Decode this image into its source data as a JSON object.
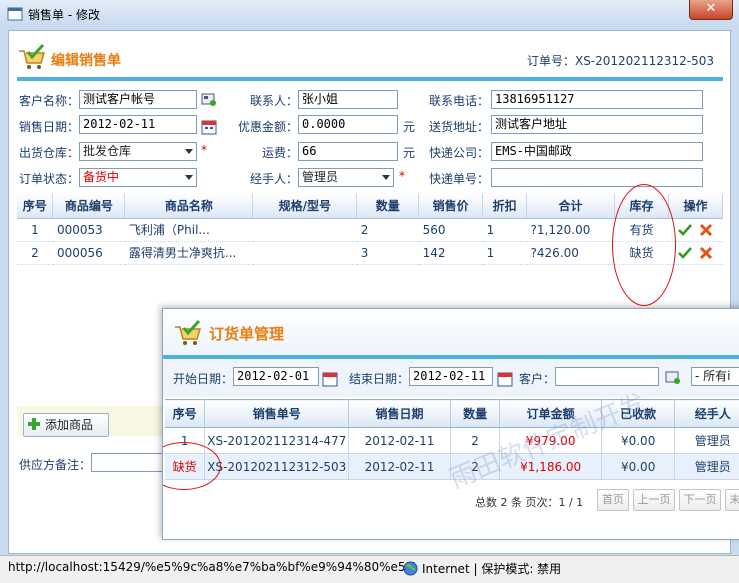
{
  "window": {
    "title": "销售单 - 修改",
    "close_label": "✕"
  },
  "form": {
    "header_title": "编辑销售单",
    "order_no_label": "订单号：",
    "order_no": "XS-201202112312-503",
    "customer_label": "客户名称：",
    "customer": "测试客户帐号",
    "contact_label": "联系人：",
    "contact": "张小姐",
    "phone_label": "联系电话：",
    "phone": "13816951127",
    "date_label": "销售日期：",
    "date": "2012-02-11",
    "discount_label": "优惠金额：",
    "discount": "0.0000",
    "discount_unit": "元",
    "address_label": "送货地址：",
    "address": "测试客户地址",
    "warehouse_label": "出货仓库：",
    "warehouse": "批发仓库",
    "freight_label": "运费：",
    "freight": "66",
    "freight_unit": "元",
    "courier_label": "快递公司：",
    "courier": "EMS-中国邮政",
    "status_label": "订单状态：",
    "status": "备货中",
    "handler_label": "经手人：",
    "handler": "管理员",
    "tracking_label": "快递单号：",
    "tracking": "",
    "required_mark": "*"
  },
  "detail": {
    "headers": [
      "序号",
      "商品编号",
      "商品名称",
      "规格/型号",
      "数量",
      "销售价",
      "折扣",
      "合计",
      "库存",
      "操作"
    ],
    "rows": [
      {
        "no": "1",
        "code": "000053",
        "name": "飞利浦（Phil...",
        "spec": "",
        "qty": "2",
        "price": "560",
        "discount": "1",
        "total": "?1,120.00",
        "stock": "有货"
      },
      {
        "no": "2",
        "code": "000056",
        "name": "露得清男士净爽抗...",
        "spec": "",
        "qty": "3",
        "price": "142",
        "discount": "1",
        "total": "?426.00",
        "stock": "缺货"
      }
    ],
    "add_button": "添加商品",
    "supplier_label": "供应方备注："
  },
  "statusbar": {
    "url": "http://localhost:15429/%e5%9c%a8%e7%ba%bf%e9%94%80%e5%",
    "zone": "Internet | 保护模式: 禁用"
  },
  "overlay": {
    "title": "订货单管理",
    "start_label": "开始日期：",
    "start": "2012-02-01",
    "end_label": "结束日期：",
    "end": "2012-02-11",
    "customer_label": "客户：",
    "customer": "",
    "all_option": "- 所有i",
    "headers": [
      "序号",
      "销售单号",
      "销售日期",
      "数量",
      "订单金额",
      "已收款",
      "经手人"
    ],
    "rows": [
      {
        "no": "1",
        "order": "XS-201202112314-477",
        "date": "2012-02-11",
        "qty": "2",
        "amount": "¥979.00",
        "paid": "¥0.00",
        "handler": "管理员"
      },
      {
        "no": "缺货",
        "order": "XS-201202112312-503",
        "date": "2012-02-11",
        "qty": "2",
        "amount": "¥1,186.00",
        "paid": "¥0.00",
        "handler": "管理员"
      }
    ],
    "pager_text": "总数 2 条 页次：1 / 1",
    "first": "首页",
    "prev": "上一页",
    "next": "下一页",
    "last": "末",
    "watermark": "雨田软件定制开发"
  },
  "colors": {
    "accent_orange": "#e87d12",
    "header_blue": "#4fb1e0",
    "red": "#dd0000"
  }
}
